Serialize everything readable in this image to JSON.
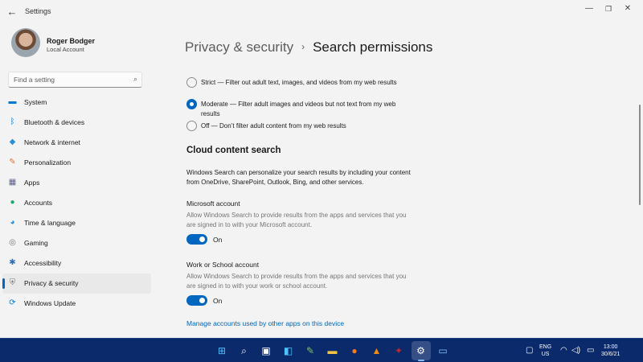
{
  "window": {
    "title": "Settings",
    "back_glyph": "←",
    "minimize_glyph": "—",
    "maximize_glyph": "❐",
    "close_glyph": "✕"
  },
  "profile": {
    "name": "Roger Bodger",
    "account_type": "Local Account"
  },
  "search": {
    "placeholder": "Find a setting",
    "icon": "search-icon"
  },
  "sidebar": {
    "items": [
      {
        "label": "System",
        "icon": "monitor-icon",
        "glyph": "▬",
        "color": "#0078d4"
      },
      {
        "label": "Bluetooth & devices",
        "icon": "bluetooth-icon",
        "glyph": "ᛒ",
        "color": "#0078d4"
      },
      {
        "label": "Network & internet",
        "icon": "wifi-icon",
        "glyph": "◆",
        "color": "#2a8fd8"
      },
      {
        "label": "Personalization",
        "icon": "brush-icon",
        "glyph": "✎",
        "color": "#e3733a"
      },
      {
        "label": "Apps",
        "icon": "apps-icon",
        "glyph": "▦",
        "color": "#5e5e8c"
      },
      {
        "label": "Accounts",
        "icon": "person-icon",
        "glyph": "●",
        "color": "#1fa46b"
      },
      {
        "label": "Time & language",
        "icon": "globe-clock-icon",
        "glyph": "◕",
        "color": "#2a8fd8"
      },
      {
        "label": "Gaming",
        "icon": "controller-icon",
        "glyph": "◎",
        "color": "#7a7a7a"
      },
      {
        "label": "Accessibility",
        "icon": "accessibility-icon",
        "glyph": "✱",
        "color": "#2a6fc0"
      },
      {
        "label": "Privacy & security",
        "icon": "shield-icon",
        "glyph": "⛨",
        "color": "#7a7a7a"
      },
      {
        "label": "Windows Update",
        "icon": "update-icon",
        "glyph": "⟳",
        "color": "#0078d4"
      }
    ],
    "active_index": 9
  },
  "breadcrumb": {
    "parent": "Privacy & security",
    "separator": "›",
    "current": "Search permissions"
  },
  "safesearch": {
    "options": [
      {
        "label": "Strict — Filter out adult text, images, and videos from my web results",
        "checked": false
      },
      {
        "label": "Moderate — Filter adult images and videos but not text from my web results",
        "checked": true
      },
      {
        "label": "Off — Don’t filter adult content from my web results",
        "checked": false
      }
    ]
  },
  "cloud": {
    "title": "Cloud content search",
    "description": "Windows Search can personalize your search results by including your content from OneDrive, SharePoint, Outlook, Bing, and other services.",
    "microsoft": {
      "title": "Microsoft account",
      "description": "Allow Windows Search to provide results from the apps and services that you are signed in to with your Microsoft account.",
      "toggle_label": "On",
      "enabled": true
    },
    "work": {
      "title": "Work or School account",
      "description": "Allow Windows Search to provide results from the apps and services that you are signed in to with your work or school account.",
      "toggle_label": "On",
      "enabled": true
    },
    "manage_link": "Manage accounts used by other apps on this device"
  },
  "taskbar": {
    "apps": [
      {
        "icon": "windows-start-icon",
        "glyph": "⊞",
        "color": "#4cc2ff"
      },
      {
        "icon": "search-icon",
        "glyph": "⌕",
        "color": "#ffffff"
      },
      {
        "icon": "task-view-icon",
        "glyph": "▣",
        "color": "#ffffff"
      },
      {
        "icon": "widgets-icon",
        "glyph": "◧",
        "color": "#4cc2ff"
      },
      {
        "icon": "notepad-icon",
        "glyph": "✎",
        "color": "#7cc36a"
      },
      {
        "icon": "file-explorer-icon",
        "glyph": "▬",
        "color": "#f3c342"
      },
      {
        "icon": "firefox-icon",
        "glyph": "●",
        "color": "#ff7a1a"
      },
      {
        "icon": "vlc-icon",
        "glyph": "▲",
        "color": "#f08a10"
      },
      {
        "icon": "wine-icon",
        "glyph": "✦",
        "color": "#c0282d"
      },
      {
        "icon": "settings-icon",
        "glyph": "⚙",
        "color": "#ffffff"
      },
      {
        "icon": "remote-desktop-icon",
        "glyph": "▭",
        "color": "#7fc6f2"
      }
    ],
    "active_index": 9,
    "language": "ENG",
    "region": "US",
    "time": "13:00",
    "date": "30/6/21",
    "tray_icons": [
      {
        "icon": "tablet-icon",
        "glyph": "▢"
      },
      {
        "icon": "wifi-icon",
        "glyph": "◠"
      },
      {
        "icon": "volume-icon",
        "glyph": "◁)"
      },
      {
        "icon": "battery-icon",
        "glyph": "▭"
      }
    ]
  }
}
